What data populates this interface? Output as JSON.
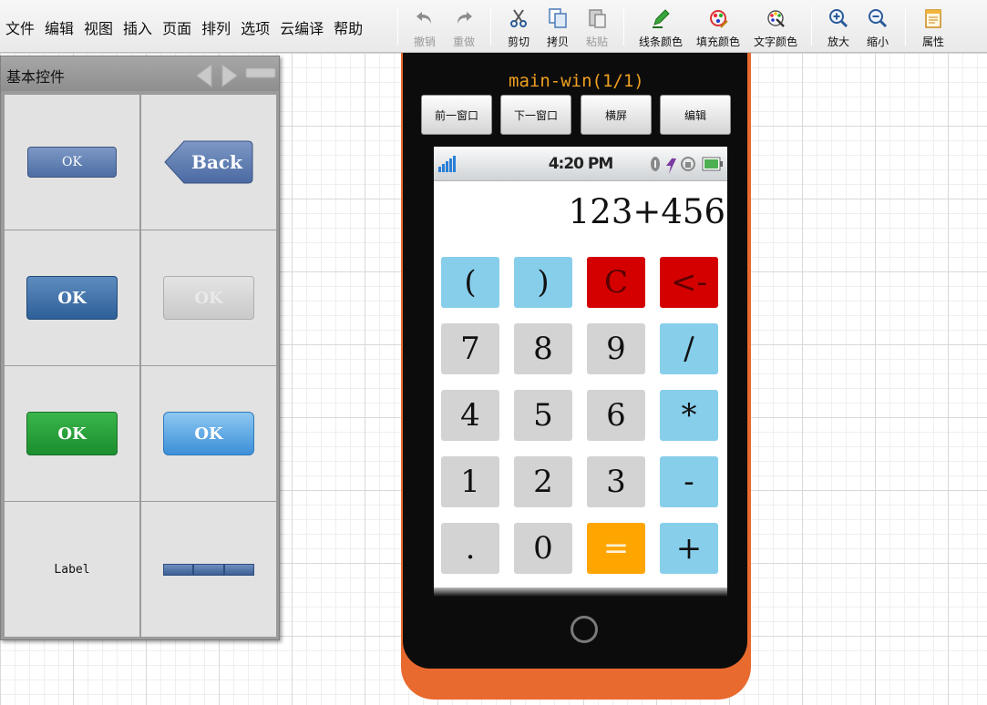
{
  "menu": [
    "文件",
    "编辑",
    "视图",
    "插入",
    "页面",
    "排列",
    "选项",
    "云编译",
    "帮助"
  ],
  "toolbar": {
    "undo": "撤销",
    "redo": "重做",
    "cut": "剪切",
    "copy": "拷贝",
    "paste": "粘贴",
    "line_color": "线条颜色",
    "fill_color": "填充颜色",
    "text_color": "文字颜色",
    "zoom_in": "放大",
    "zoom_out": "缩小",
    "properties": "属性"
  },
  "palette": {
    "title": "基本控件",
    "widgets": {
      "ok_small": "OK",
      "back": "Back",
      "ok_blue": "OK",
      "ok_disabled": "OK",
      "ok_green": "OK",
      "ok_light": "OK",
      "label": "Label"
    }
  },
  "simulator": {
    "window_title": "main-win(1/1)",
    "buttons": {
      "prev": "前一窗口",
      "next": "下一窗口",
      "landscape": "横屏",
      "edit": "编辑"
    },
    "status_time": "4:20 PM",
    "display": "123+456",
    "keys": [
      [
        "(",
        ")",
        "C",
        "<-"
      ],
      [
        "7",
        "8",
        "9",
        "/"
      ],
      [
        "4",
        "5",
        "6",
        "*"
      ],
      [
        "1",
        "2",
        "3",
        "-"
      ],
      [
        ".",
        "0",
        "=",
        "+"
      ]
    ]
  },
  "colors": {
    "phone_body": "#e86a2f",
    "key_blue": "#87ceeb",
    "key_gray": "#d3d3d3",
    "key_red": "#d40000",
    "key_orange": "#ffa500",
    "title_orange": "#f0a020"
  }
}
